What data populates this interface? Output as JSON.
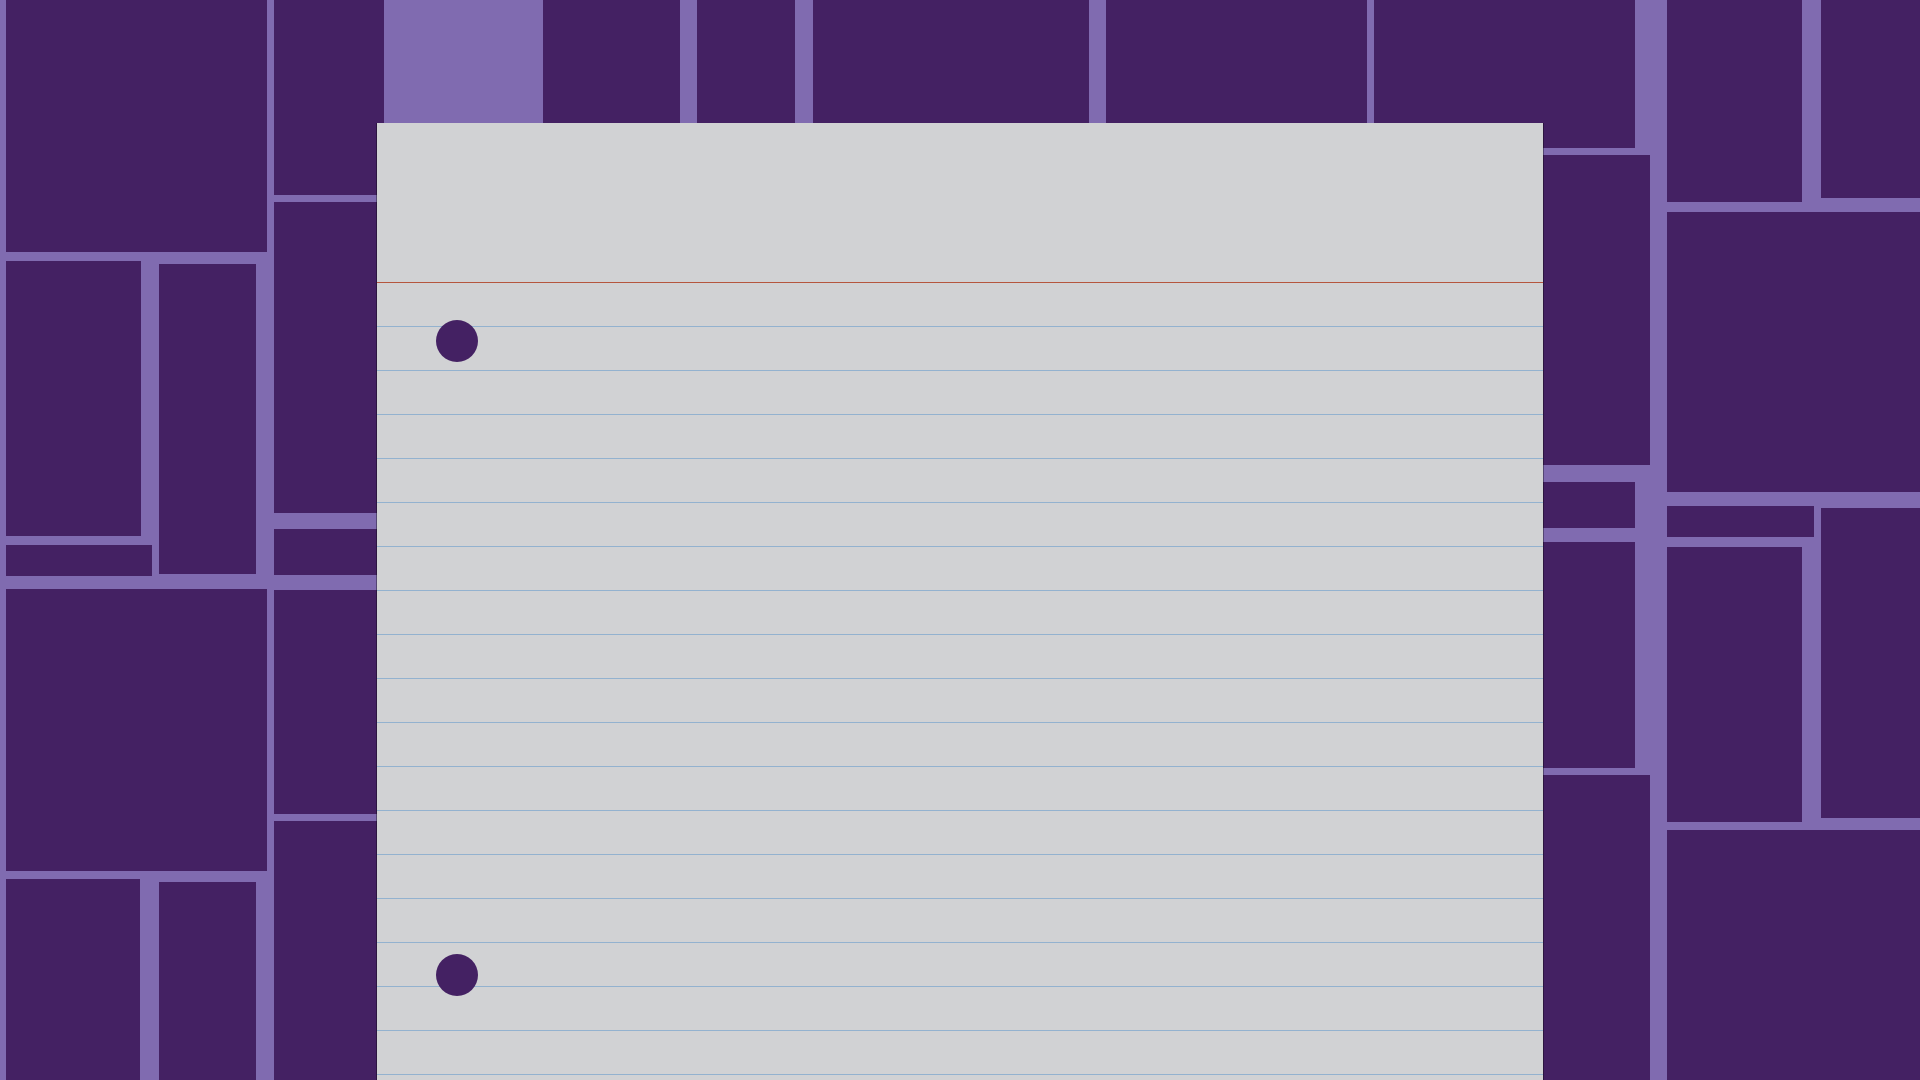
{
  "colors": {
    "background_gap": "#806bb0",
    "background_tile": "#442163",
    "paper": "#d1d2d4",
    "margin_line": "#b5563e",
    "rule_line": "#93b2cf",
    "punch_hole": "#442163"
  },
  "paper": {
    "style": "ruled notebook paper",
    "header_text": "",
    "punch_hole_count": 2
  }
}
